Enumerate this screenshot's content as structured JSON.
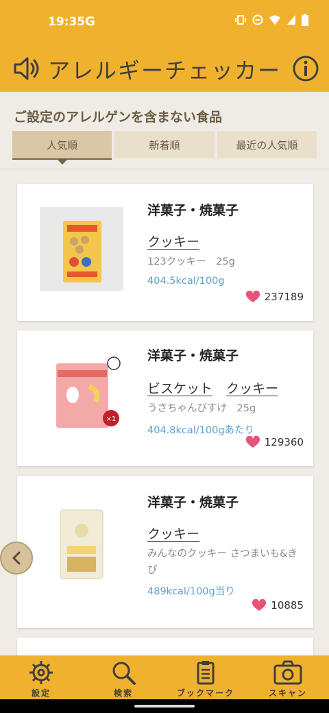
{
  "status": {
    "time": "19:35",
    "g": "G"
  },
  "appbar": {
    "title": "アレルギーチェッカー",
    "sound_icon": "speaker-icon",
    "info_icon": "info-icon"
  },
  "section_title": "ご設定のアレルゲンを含まない食品",
  "tabs": [
    {
      "label": "人気順",
      "active": true
    },
    {
      "label": "新着順",
      "active": false
    },
    {
      "label": "最近の人気順",
      "active": false
    }
  ],
  "products": [
    {
      "category": "洋菓子・焼菓子",
      "links": [
        "クッキー"
      ],
      "name": "123クッキー　25g",
      "kcal": "404.5kcal/100g",
      "likes": "237189"
    },
    {
      "category": "洋菓子・焼菓子",
      "links": [
        "ビスケット",
        "クッキー"
      ],
      "name": "うさちゃんびすけ　25g",
      "kcal": "404.8kcal/100gあたり",
      "likes": "129360"
    },
    {
      "category": "洋菓子・焼菓子",
      "links": [
        "クッキー"
      ],
      "name": "みんなのクッキー さつまいも&きび",
      "kcal": "489kcal/100g当り",
      "likes": "10885"
    }
  ],
  "nav": [
    {
      "label": "設定",
      "icon": "gear-icon"
    },
    {
      "label": "検索",
      "icon": "search-icon"
    },
    {
      "label": "ブックマーク",
      "icon": "bookmark-list-icon"
    },
    {
      "label": "スキャン",
      "icon": "camera-icon"
    }
  ],
  "colors": {
    "accent": "#f0b22e",
    "kcal": "#5aa0c8",
    "heart": "#e8537a"
  }
}
